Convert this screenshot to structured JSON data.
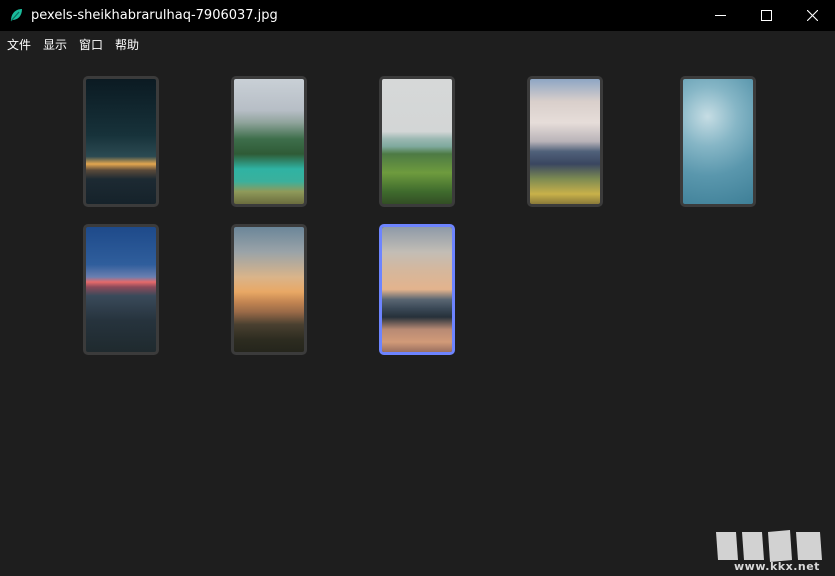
{
  "window": {
    "title": "pexels-sheikhabrarulhaq-7906037.jpg"
  },
  "menu": {
    "items": [
      "文件",
      "显示",
      "窗口",
      "帮助"
    ]
  },
  "thumbnails": [
    {
      "selected": false
    },
    {
      "selected": false
    },
    {
      "selected": false
    },
    {
      "selected": false
    },
    {
      "selected": false
    },
    {
      "selected": false
    },
    {
      "selected": false
    },
    {
      "selected": true
    }
  ],
  "watermark": {
    "text": "www.kkx.net",
    "logo_letters": "KK下载"
  },
  "colors": {
    "titlebar": "#000000",
    "background": "#1e1e1e",
    "thumb_border": "#3b3b3b",
    "selected_border": "#6d84ff",
    "app_icon": "#1abc9c"
  }
}
